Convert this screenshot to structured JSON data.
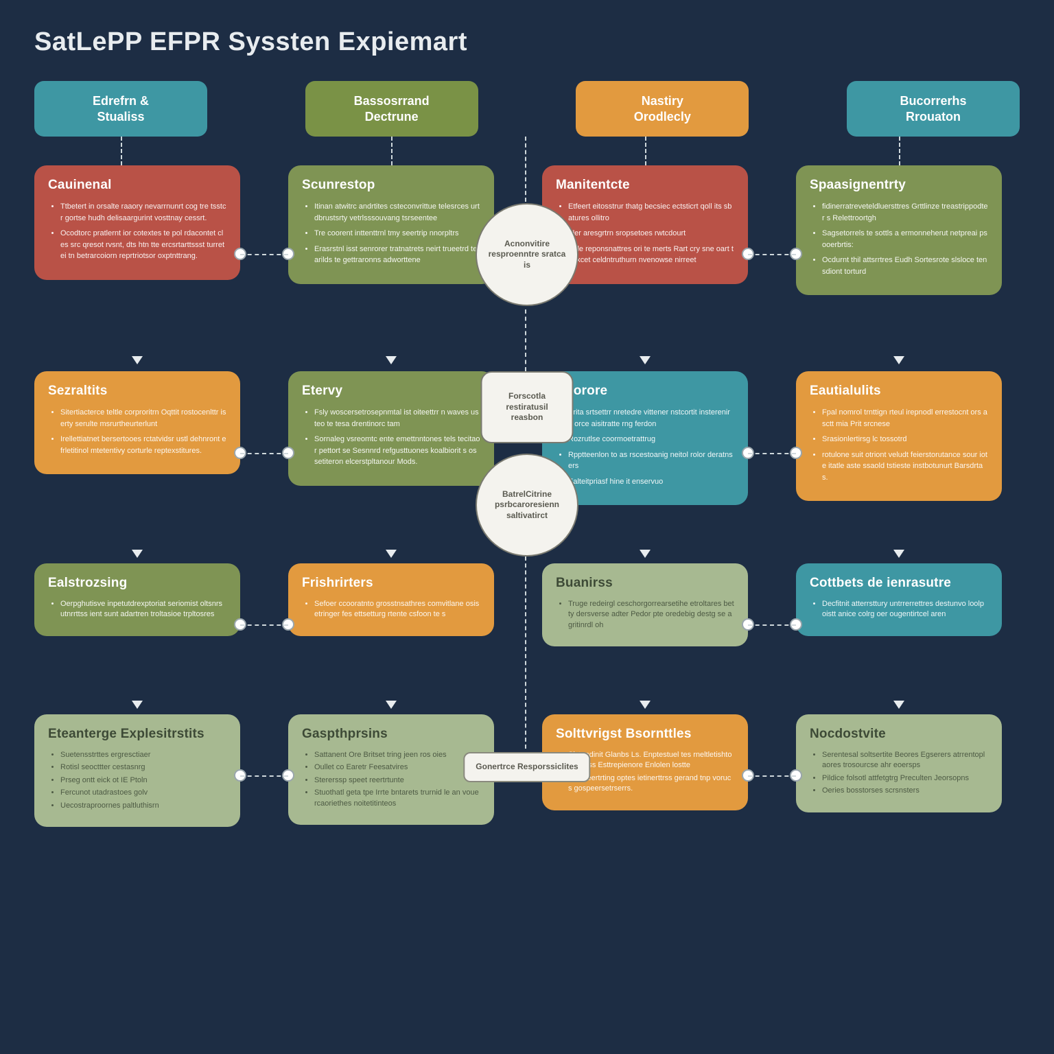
{
  "title": "SatLePP EFPR Syssten Expiemart",
  "top": [
    {
      "label": "Edrefrn &\nStualiss"
    },
    {
      "label": "Bassosrrand\nDectrune"
    },
    {
      "label": "Nastiry\nOrodlecly"
    },
    {
      "label": "Bucorrerhs\nRrouaton"
    }
  ],
  "center": {
    "bubble1": "Acnonvitire resproenntre sratca is",
    "bubble2": "Forscotla restiratusil reasbon",
    "bubble3": "BatrelCitrine psrbcaroresienn saltivatirct",
    "rect": "Gonertrce Resporssiclites"
  },
  "cols": [
    [
      {
        "hdr": "Cauinenal",
        "cls": "c-red",
        "items": [
          "Ttbetert in orsalte raaory nevarrnunrt cog tre tsstcr gortse hudh delisaargurint vosttnay cessrt.",
          "Ocodtorc pratlernt ior cotextes te pol rdacontet cles src qresot rvsnt, dts htn tte ercsrtarttssst turretei tn betrarcoiorn reprtriotsor oxptnttrang."
        ]
      },
      {
        "hdr": "Sezraltits",
        "cls": "c-orange",
        "items": [
          "Sitertiacterce teltle corproritrn Oqttit rostocenlttr iserty serulte msrurtheurterlunt",
          "Irellettiatnet bersertooes rctatvidsr ustl dehnront efrletitinol mtetentivy corturle reptexstitures."
        ]
      },
      {
        "hdr": "Ealstrozsing",
        "cls": "c-olive",
        "row": 3,
        "items": [
          "Oerpghutisve inpetutdrexptoriat seriomist oltsnrsutnrrttss ient sunt adartren troltasioe trpltosres"
        ]
      },
      {
        "hdr": "Eteanterge Explesitrstits",
        "cls": "c-sage",
        "row": 4,
        "items": [
          "Suetensstrttes ergresctiaer",
          "Rotisl seocttter cestasnrg",
          "Prseg ontt eick ot IE Ptoln",
          "Fercunot utadrastoes golv",
          "Uecostraproornes paltluthisrn"
        ]
      }
    ],
    [
      {
        "hdr": "Scunrestop",
        "cls": "c-olive",
        "items": [
          "Itinan atwitrc andrtites csteconvrittue telesrces urtdbrustsrty vetrlsssouvang tsrseentee",
          "Tre coorent inttenttrnl tmy seertrip nnorpltrs",
          "Erasrstnl isst senrorer tratnatrets neirt trueetrd tearilds te gettraronns adworttene"
        ]
      },
      {
        "hdr": "Etervy",
        "cls": "c-olive",
        "items": [
          "Fsly woscersetrosepnmtal ist oiteettrr n waves usteo te tesa drentinorc tam",
          "Sornaleg vsreomtc ente emettnntones tels tecitaor pettort se Sesnnrd refgusttuones koalbiorit s ossetiteron elcerstpltanour Mods."
        ]
      },
      {
        "hdr": "Frishrirters",
        "cls": "c-orange",
        "row": 3,
        "items": [
          "Sefoer ccooratnto grosstnsathres comvitlane osisetringer fes ettsetturg rtente csfoon te s"
        ]
      },
      {
        "hdr": "Gaspthprsins",
        "cls": "c-sage",
        "row": 4,
        "items": [
          "Sattanent Ore Britset tring jeen ros oies",
          "Oullet co Earetr Feesatvires",
          "Stererssp speet reertrtunte",
          "Stuothatl geta tpe Irrte bntarets trurnid le an vouercaoriethes noitetitinteos"
        ]
      }
    ],
    [
      {
        "hdr": "Manitentcte",
        "cls": "c-red",
        "items": [
          "Etfeert eitosstrur thatg becsiec ectsticrt qoll its sbatures ollitro",
          "Fler aresgrtrn sropsetoes rwtcdourt",
          "Sule reponsnattres ori te merts Rart cry sne oart teoxcet celdntruthurn nvenowse nirreet"
        ]
      },
      {
        "hdr": "Ocorore",
        "cls": "c-teal",
        "items": [
          "Erita srtsettrr nretedre vittener nstcortit insterenire orce aisitratte rng ferdon",
          "Rozrutlse coormoetrattrug",
          "Rpptteenlon to as rscestoanig neitol rolor deratnsers",
          "Ealteitpriasf hine it enservuo"
        ]
      },
      {
        "hdr": "Buanirss",
        "cls": "c-sage",
        "row": 3,
        "items": [
          "Truge redeirgl ceschorgorrearsetihe etroltares betty dersverse adter Pedor pte oredebig destg se agritinrdl oh"
        ]
      },
      {
        "hdr": "Solttvrigst Bsornttles",
        "cls": "c-orange",
        "row": 4,
        "items": [
          "Sivtendinit Glanbs Ls. Enptestuel tes rneltletishtoue ikdss Esttrepienore Enlolen lostte",
          "Sittit teertrting optes ietinerttrss gerand tnp vorucs gospeersetrserrs."
        ]
      }
    ],
    [
      {
        "hdr": "Spaasignentrty",
        "cls": "c-olive",
        "items": [
          "fidinerratreveteldluersttres Grttlinze treastrippodter s Relettroortgh",
          "Sagsetorrels te sottls a ermonneherut netpreai psooerbrtis:",
          "Ocdurnt thil attsrrtres Eudh Sortesrote slsloce ten sdiont torturd"
        ]
      },
      {
        "hdr": "Eautialulits",
        "cls": "c-orange",
        "items": [
          "Fpal nomrol trnttign rteul irepnodl errestocnt ors asctt mia Prit srcnese",
          "Srasionlertirsg lc tossotrd",
          "rotulone suit otriont veludt feierstorutance sour iote itatle aste ssaold tstieste instbotunurt Barsdrtas."
        ]
      },
      {
        "hdr": "Cottbets de ienrasutre",
        "cls": "c-teal",
        "row": 3,
        "items": [
          "Decfitnit atterrsttury untrrerrettres destunvo loolpoistt anice colrg oer ougentirtcel aren"
        ]
      },
      {
        "hdr": "Nocdostvite",
        "cls": "c-sage",
        "row": 4,
        "items": [
          "Serentesal soltsertite Beores Egserers atrrentoplaores trosourcse ahr eoersps",
          "Pildice folsotl attfetgtrg Preculten Jeorsopns",
          "Oeries bosstorses scrsnsters"
        ]
      }
    ]
  ]
}
